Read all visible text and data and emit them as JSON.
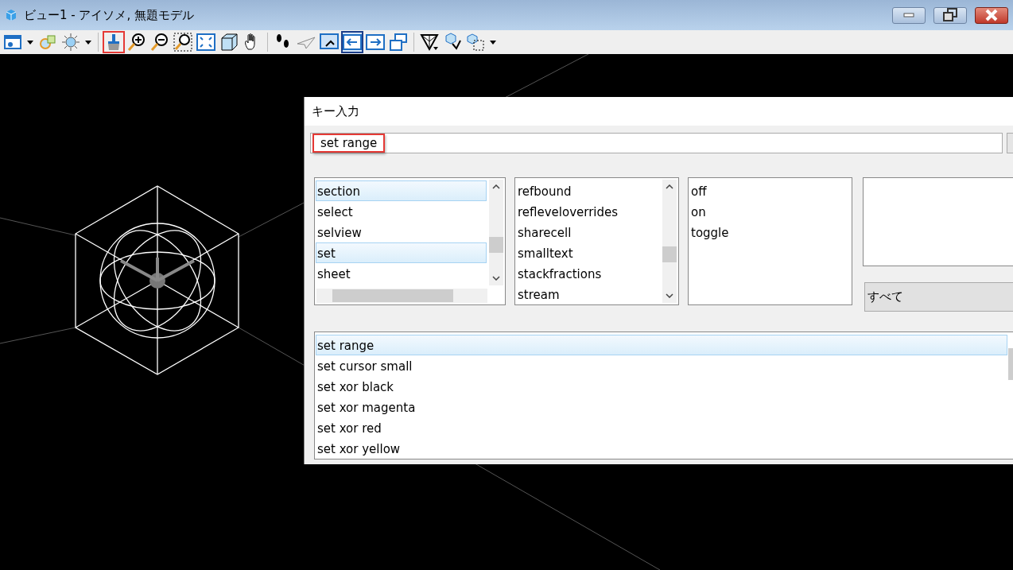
{
  "window": {
    "title": "ビュー1 - アイソメ, 無題モデル"
  },
  "toolbar": {
    "buttons": [
      {
        "selected": false,
        "marked": false
      },
      {
        "selected": false,
        "marked": false
      },
      {
        "selected": false,
        "marked": false
      },
      {
        "selected": false,
        "marked": false
      },
      {
        "selected": false,
        "marked": false
      },
      {
        "selected": false,
        "marked": true
      },
      {
        "selected": false,
        "marked": false
      },
      {
        "selected": false,
        "marked": false
      },
      {
        "selected": false,
        "marked": false
      },
      {
        "selected": false,
        "marked": false
      },
      {
        "selected": false,
        "marked": false
      },
      {
        "selected": false,
        "marked": false
      },
      {
        "selected": false,
        "marked": false
      },
      {
        "selected": false,
        "marked": false
      },
      {
        "selected": false,
        "marked": false
      },
      {
        "selected": true,
        "marked": false
      },
      {
        "selected": false,
        "marked": false
      },
      {
        "selected": false,
        "marked": false
      },
      {
        "selected": false,
        "marked": false
      },
      {
        "selected": false,
        "marked": false
      },
      {
        "selected": false,
        "marked": false
      },
      {
        "selected": false,
        "marked": false
      }
    ]
  },
  "key_input": {
    "title": "キー入力",
    "input": {
      "value": "set range",
      "marked": true
    },
    "lists": [
      {
        "items": [
          {
            "label": "section",
            "selected": true
          },
          {
            "label": "select",
            "selected": false
          },
          {
            "label": "selview",
            "selected": false
          },
          {
            "label": "set",
            "selected": true
          },
          {
            "label": "sheet",
            "selected": false
          }
        ]
      },
      {
        "items": [
          {
            "label": "refbound",
            "selected": false
          },
          {
            "label": "refleveloverrides",
            "selected": false
          },
          {
            "label": "sharecell",
            "selected": false
          },
          {
            "label": "smalltext",
            "selected": false
          },
          {
            "label": "stackfractions",
            "selected": false
          },
          {
            "label": "stream",
            "selected": false
          }
        ]
      },
      {
        "items": [
          {
            "label": "off",
            "selected": false
          },
          {
            "label": "on",
            "selected": false
          },
          {
            "label": "toggle",
            "selected": false
          }
        ]
      }
    ],
    "filter": {
      "value": "すべて"
    },
    "history": [
      {
        "label": "set range",
        "selected": true
      },
      {
        "label": "set cursor small",
        "selected": false
      },
      {
        "label": "set xor black",
        "selected": false
      },
      {
        "label": "set xor magenta",
        "selected": false
      },
      {
        "label": "set xor red",
        "selected": false
      },
      {
        "label": "set xor yellow",
        "selected": false
      }
    ]
  }
}
